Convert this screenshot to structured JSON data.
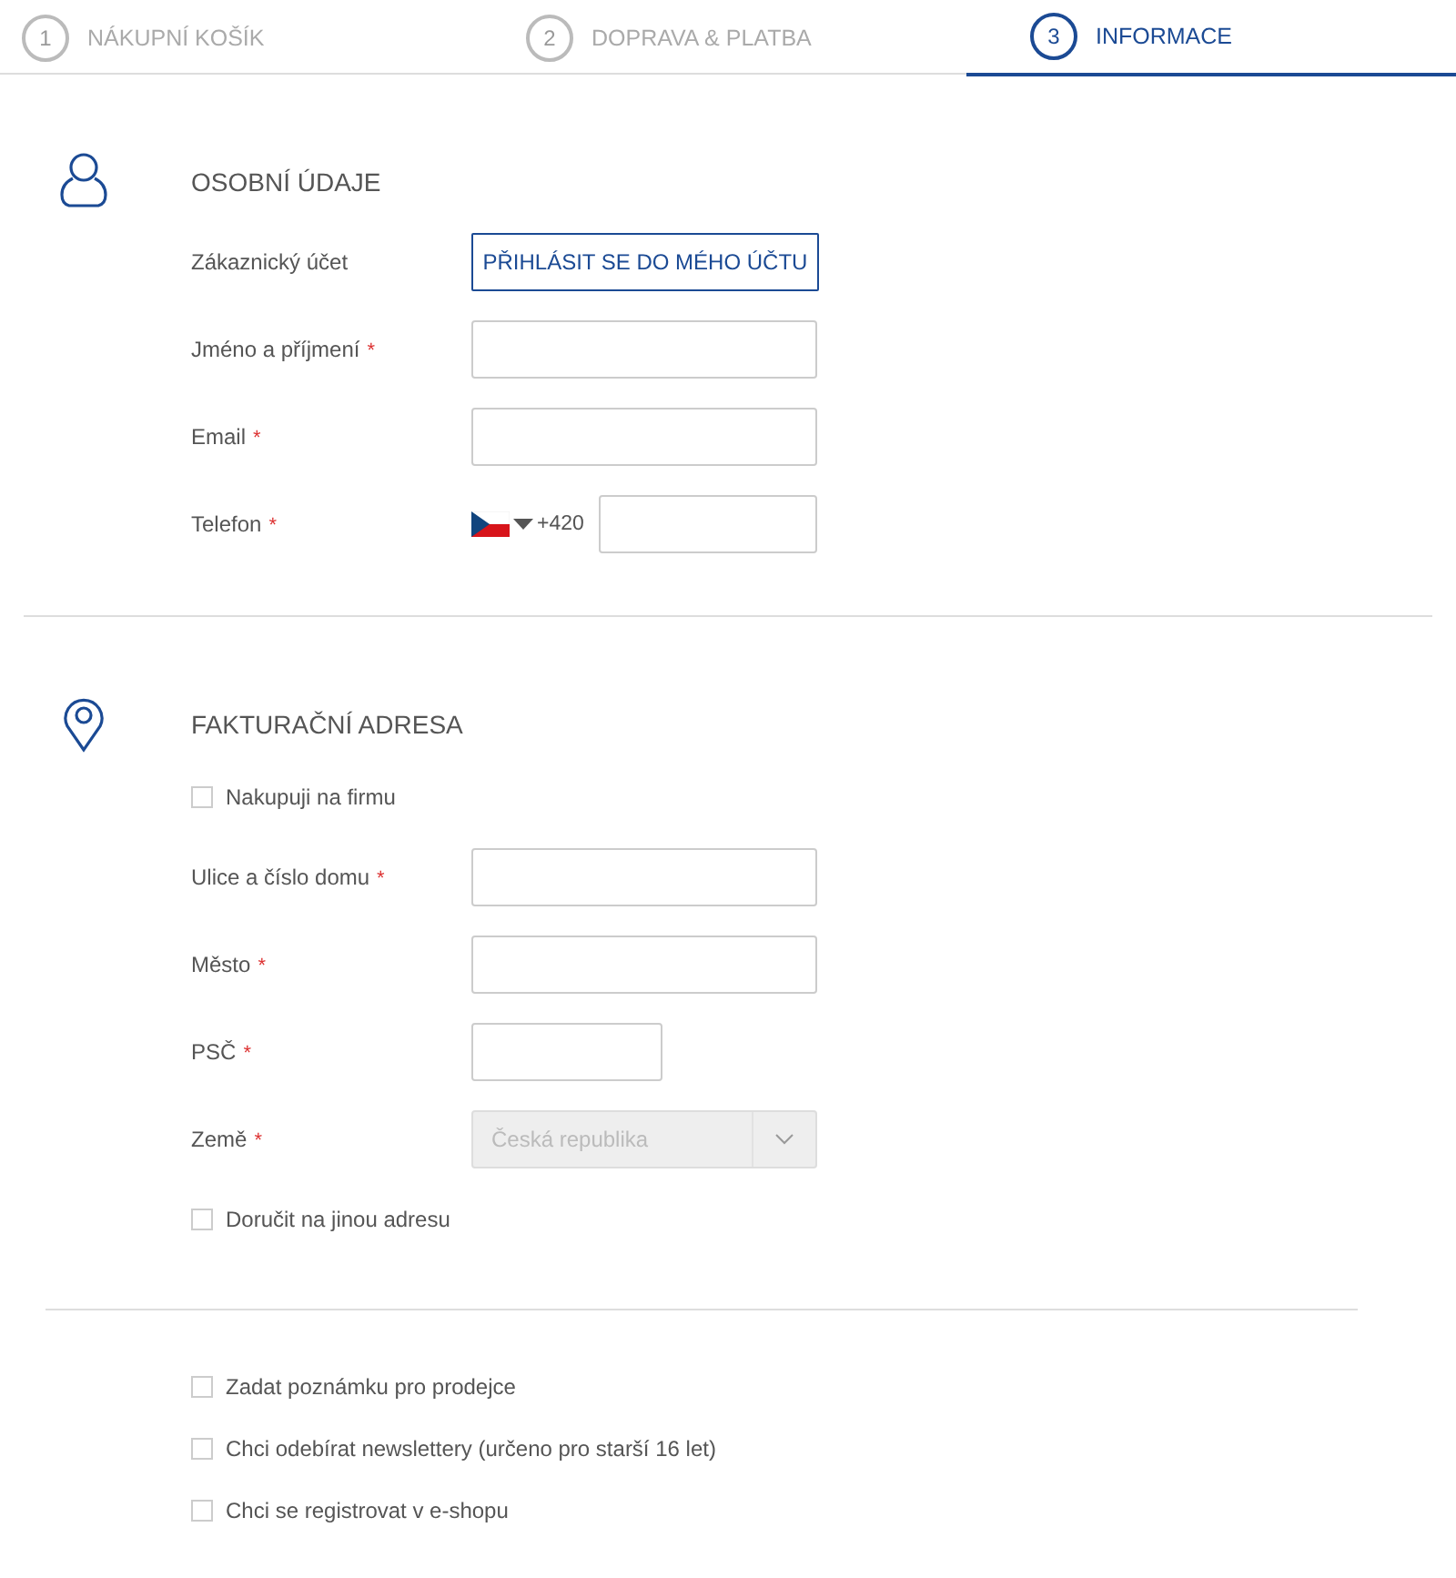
{
  "steps": [
    {
      "number": "1",
      "label": "NÁKUPNÍ KOŠÍK",
      "selected": false
    },
    {
      "number": "2",
      "label": "DOPRAVA & PLATBA",
      "selected": false
    },
    {
      "number": "3",
      "label": "INFORMACE",
      "selected": true
    }
  ],
  "sections": [
    {
      "kind": "personal",
      "heading": "OSOBNÍ ÚDAJE",
      "rows": [
        {
          "kind": "button",
          "label": "Zákaznický účet",
          "button": "PŘIHLÁSIT SE DO MÉHO ÚČTU"
        },
        {
          "kind": "input",
          "label": "Jméno a příjmení",
          "required_mark": "*"
        },
        {
          "kind": "input",
          "label": "Email",
          "required_mark": "*"
        },
        {
          "kind": "phone",
          "label": "Telefon",
          "required_mark": "*",
          "prefix": "+420"
        }
      ]
    },
    {
      "kind": "address",
      "heading": "FAKTURAČNÍ ADRESA",
      "rows": [
        {
          "kind": "checkbox",
          "label": "Nakupuji na firmu",
          "checked": false
        },
        {
          "kind": "input",
          "label": "Ulice a číslo domu",
          "required_mark": "*"
        },
        {
          "kind": "input",
          "label": "Město",
          "required_mark": "*"
        },
        {
          "kind": "short-input",
          "label": "PSČ",
          "required_mark": "*"
        },
        {
          "kind": "select",
          "label": "Země",
          "required_mark": "*",
          "value": "Česká republika",
          "disabled": true
        },
        {
          "kind": "checkbox",
          "label": "Doručit na jinou adresu",
          "checked": false
        }
      ]
    },
    {
      "rows": [
        {
          "kind": "checkbox",
          "label": "Zadat poznámku pro prodejce",
          "checked": false
        },
        {
          "kind": "checkbox",
          "label": "Chci odebírat newslettery (určeno pro starší 16 let)",
          "checked": false
        },
        {
          "kind": "checkbox",
          "label": "Chci se registrovat v e-shopu",
          "checked": false
        }
      ]
    }
  ]
}
